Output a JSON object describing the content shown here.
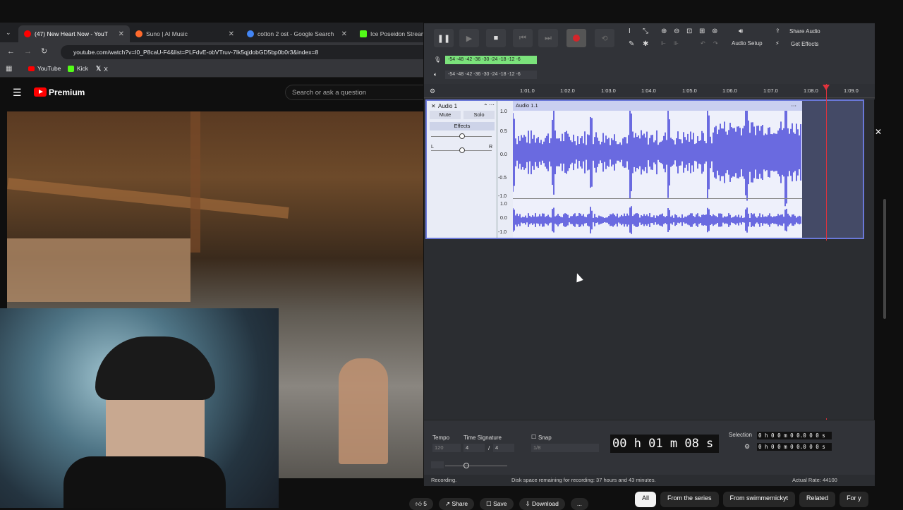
{
  "browser": {
    "tabs": [
      {
        "label": "(47) New Heart Now - YouT",
        "color": "#ff0000"
      },
      {
        "label": "Suno | AI Music",
        "color": "#ff6a2c"
      },
      {
        "label": "cotton 2 ost - Google Search",
        "color": "#4285f4"
      },
      {
        "label": "Ice Poseidon Stream -",
        "color": "#53fc18"
      }
    ],
    "url": "youtube.com/watch?v=I0_P8caU-F4&list=PLFdvE-obVTruv-7Ik5qjdobGD5bp0b0r3&index=8",
    "bookmarks": [
      "YouTube",
      "Kick",
      "X"
    ]
  },
  "youtube": {
    "logo": "Premium",
    "search_placeholder": "Search or ask a question",
    "actions": [
      "5",
      "Share",
      "Save",
      "Download",
      "..."
    ],
    "chips": [
      "All",
      "From the series",
      "From swimmernickyt",
      "Related",
      "For y"
    ]
  },
  "audacity": {
    "meter_rec": "-54 -48 -42 -36 -30 -24 -18 -12 -6",
    "meter_play": "-54 -48 -42 -36 -30 -24 -18 -12 -6",
    "audio_setup": "Audio Setup",
    "share_audio": "Share Audio",
    "get_effects": "Get Effects",
    "ruler": [
      "1:01.0",
      "1:02.0",
      "1:03.0",
      "1:04.0",
      "1:05.0",
      "1:06.0",
      "1:07.0",
      "1:08.0",
      "1:09.0"
    ],
    "track": {
      "name": "Audio 1",
      "clip": "Audio 1.1",
      "mute": "Mute",
      "solo": "Solo",
      "effects": "Effects",
      "left": "L",
      "right": "R",
      "scale_top": [
        "1.0",
        "0.5",
        "0.0",
        "-0.5",
        "-1.0"
      ],
      "scale_bottom": [
        "1.0",
        "0.0",
        "-1.0"
      ]
    },
    "bottom": {
      "tempo_label": "Tempo",
      "tempo": "120",
      "timesig_label": "Time Signature",
      "timesig_num": "4",
      "timesig_den": "4",
      "snap_label": "Snap",
      "snap_value": "1/8",
      "time": "00 h 01 m 08 s",
      "selection_label": "Selection",
      "sel_start": "0 h 0 0 m 0 0.0 0 0 s",
      "sel_end": "0 h 0 0 m 0 0.0 0 0 s"
    },
    "status": {
      "left": "Recording.",
      "center": "Disk space remaining for recording: 37 hours and 43 minutes.",
      "right": "Actual Rate: 44100"
    }
  }
}
